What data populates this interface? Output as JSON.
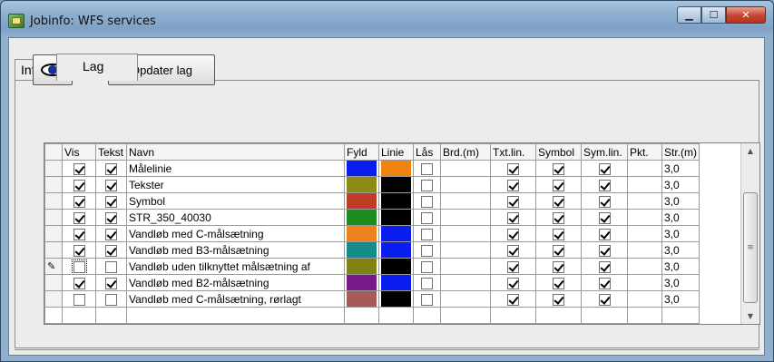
{
  "window": {
    "title": "Jobinfo: WFS services"
  },
  "tabs": [
    {
      "label": "Info"
    },
    {
      "label": "Lag"
    }
  ],
  "toolbar": {
    "update_label": "Opdater lag",
    "eye_icon": "eye-icon"
  },
  "grid": {
    "columns": [
      "",
      "Vis",
      "Tekst",
      "Navn",
      "Fyld",
      "Linie",
      "Lås",
      "Brd.(m)",
      "Txt.lin.",
      "Symbol",
      "Sym.lin.",
      "Pkt.",
      "Str.(m)"
    ],
    "rows": [
      {
        "vis": true,
        "tekst": true,
        "navn": "Målelinie",
        "fyld": "#0a1ef0",
        "linie": "#f08210",
        "laas": false,
        "txtlin": true,
        "symbol": true,
        "symlin": true,
        "str": "3,0"
      },
      {
        "vis": true,
        "tekst": true,
        "navn": "Tekster",
        "fyld": "#8c8c14",
        "linie": "#000000",
        "laas": false,
        "txtlin": true,
        "symbol": true,
        "symlin": true,
        "str": "3,0"
      },
      {
        "vis": true,
        "tekst": true,
        "navn": "Symbol",
        "fyld": "#c03c28",
        "linie": "#000000",
        "laas": false,
        "txtlin": true,
        "symbol": true,
        "symlin": true,
        "str": "3,0"
      },
      {
        "vis": true,
        "tekst": true,
        "navn": "STR_350_40030",
        "fyld": "#1e8c1e",
        "linie": "#000000",
        "laas": false,
        "txtlin": true,
        "symbol": true,
        "symlin": true,
        "str": "3,0"
      },
      {
        "vis": true,
        "tekst": true,
        "navn": "Vandløb med C-målsætning",
        "fyld": "#f0821e",
        "linie": "#0a1ef0",
        "laas": false,
        "txtlin": true,
        "symbol": true,
        "symlin": true,
        "str": "3,0"
      },
      {
        "vis": true,
        "tekst": true,
        "navn": "Vandløb med B3-målsætning",
        "fyld": "#148c8c",
        "linie": "#0a1ef0",
        "laas": false,
        "txtlin": true,
        "symbol": true,
        "symlin": true,
        "str": "3,0"
      },
      {
        "vis": false,
        "tekst": false,
        "navn": "Vandløb uden tilknyttet målsætning af",
        "fyld": "#828214",
        "linie": "#000000",
        "laas": false,
        "txtlin": true,
        "symbol": true,
        "symlin": true,
        "str": "3,0",
        "editing": true
      },
      {
        "vis": true,
        "tekst": true,
        "navn": "Vandløb med B2-målsætning",
        "fyld": "#7a1a8a",
        "linie": "#0a1ef0",
        "laas": false,
        "txtlin": true,
        "symbol": true,
        "symlin": true,
        "str": "3,0"
      },
      {
        "vis": false,
        "tekst": false,
        "navn": "Vandløb med C-målsætning, rørlagt",
        "fyld": "#a85a5a",
        "linie": "#000000",
        "laas": false,
        "txtlin": true,
        "symbol": true,
        "symlin": true,
        "str": "3,0"
      }
    ]
  }
}
